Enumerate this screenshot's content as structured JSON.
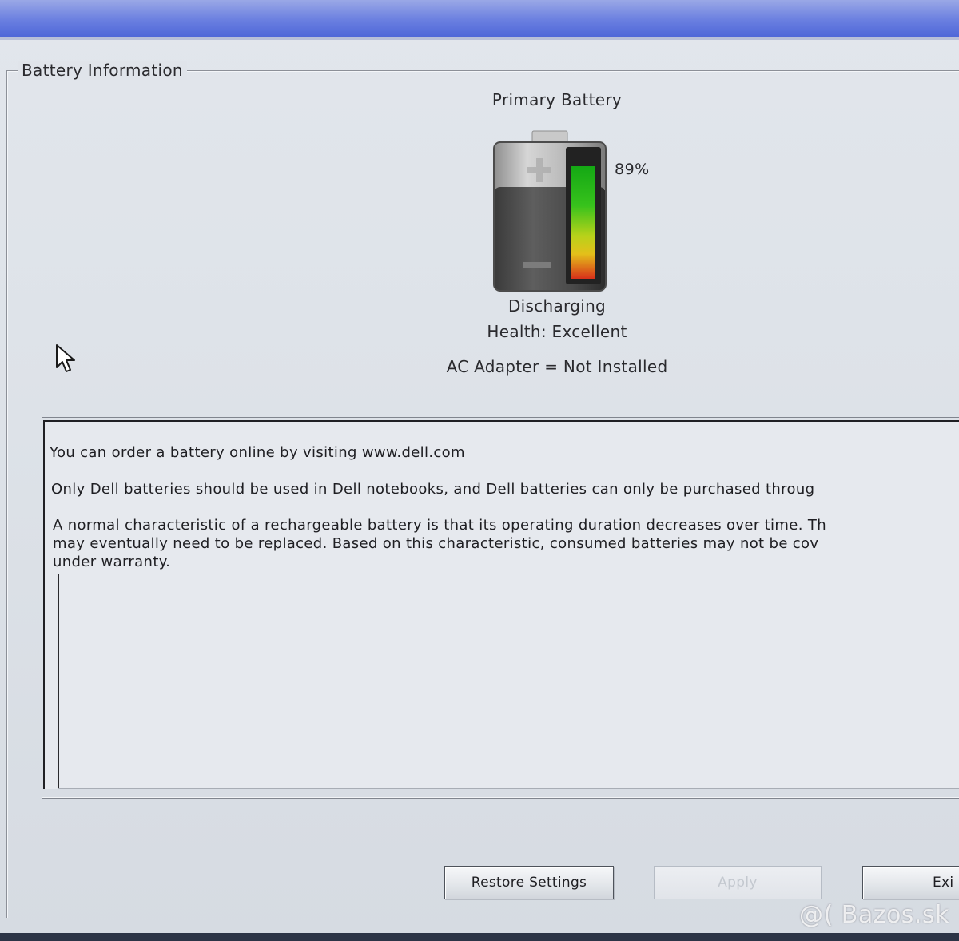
{
  "battery_info": {
    "group_title": "Battery Information",
    "battery_title": "Primary Battery",
    "charge_percent_label": "89%",
    "charge_level": 0.89,
    "state": "Discharging",
    "health": "Health: Excellent",
    "ac_adapter": "AC Adapter = Not Installed"
  },
  "info_text": {
    "para1": "You can order a battery online by visiting www.dell.com",
    "para2": "Only Dell batteries should be used in Dell notebooks, and Dell batteries can only be purchased throug",
    "para3_line1": "A normal characteristic of a rechargeable battery is that its operating duration decreases over time.  Th",
    "para3_line2": "may eventually need to be replaced.  Based on this characteristic, consumed batteries may not be cov",
    "para3_line3": "under warranty."
  },
  "buttons": {
    "restore": "Restore Settings",
    "apply": "Apply",
    "exit": "Exi"
  },
  "watermark": "@( Bazos.sk",
  "colors": {
    "title_bar": "#5a71da",
    "gauge_high": "#1fbf1f",
    "gauge_mid": "#e7d81a",
    "gauge_low": "#e23317"
  },
  "icons": {
    "battery": "battery-icon",
    "cursor": "mouse-pointer-icon"
  }
}
